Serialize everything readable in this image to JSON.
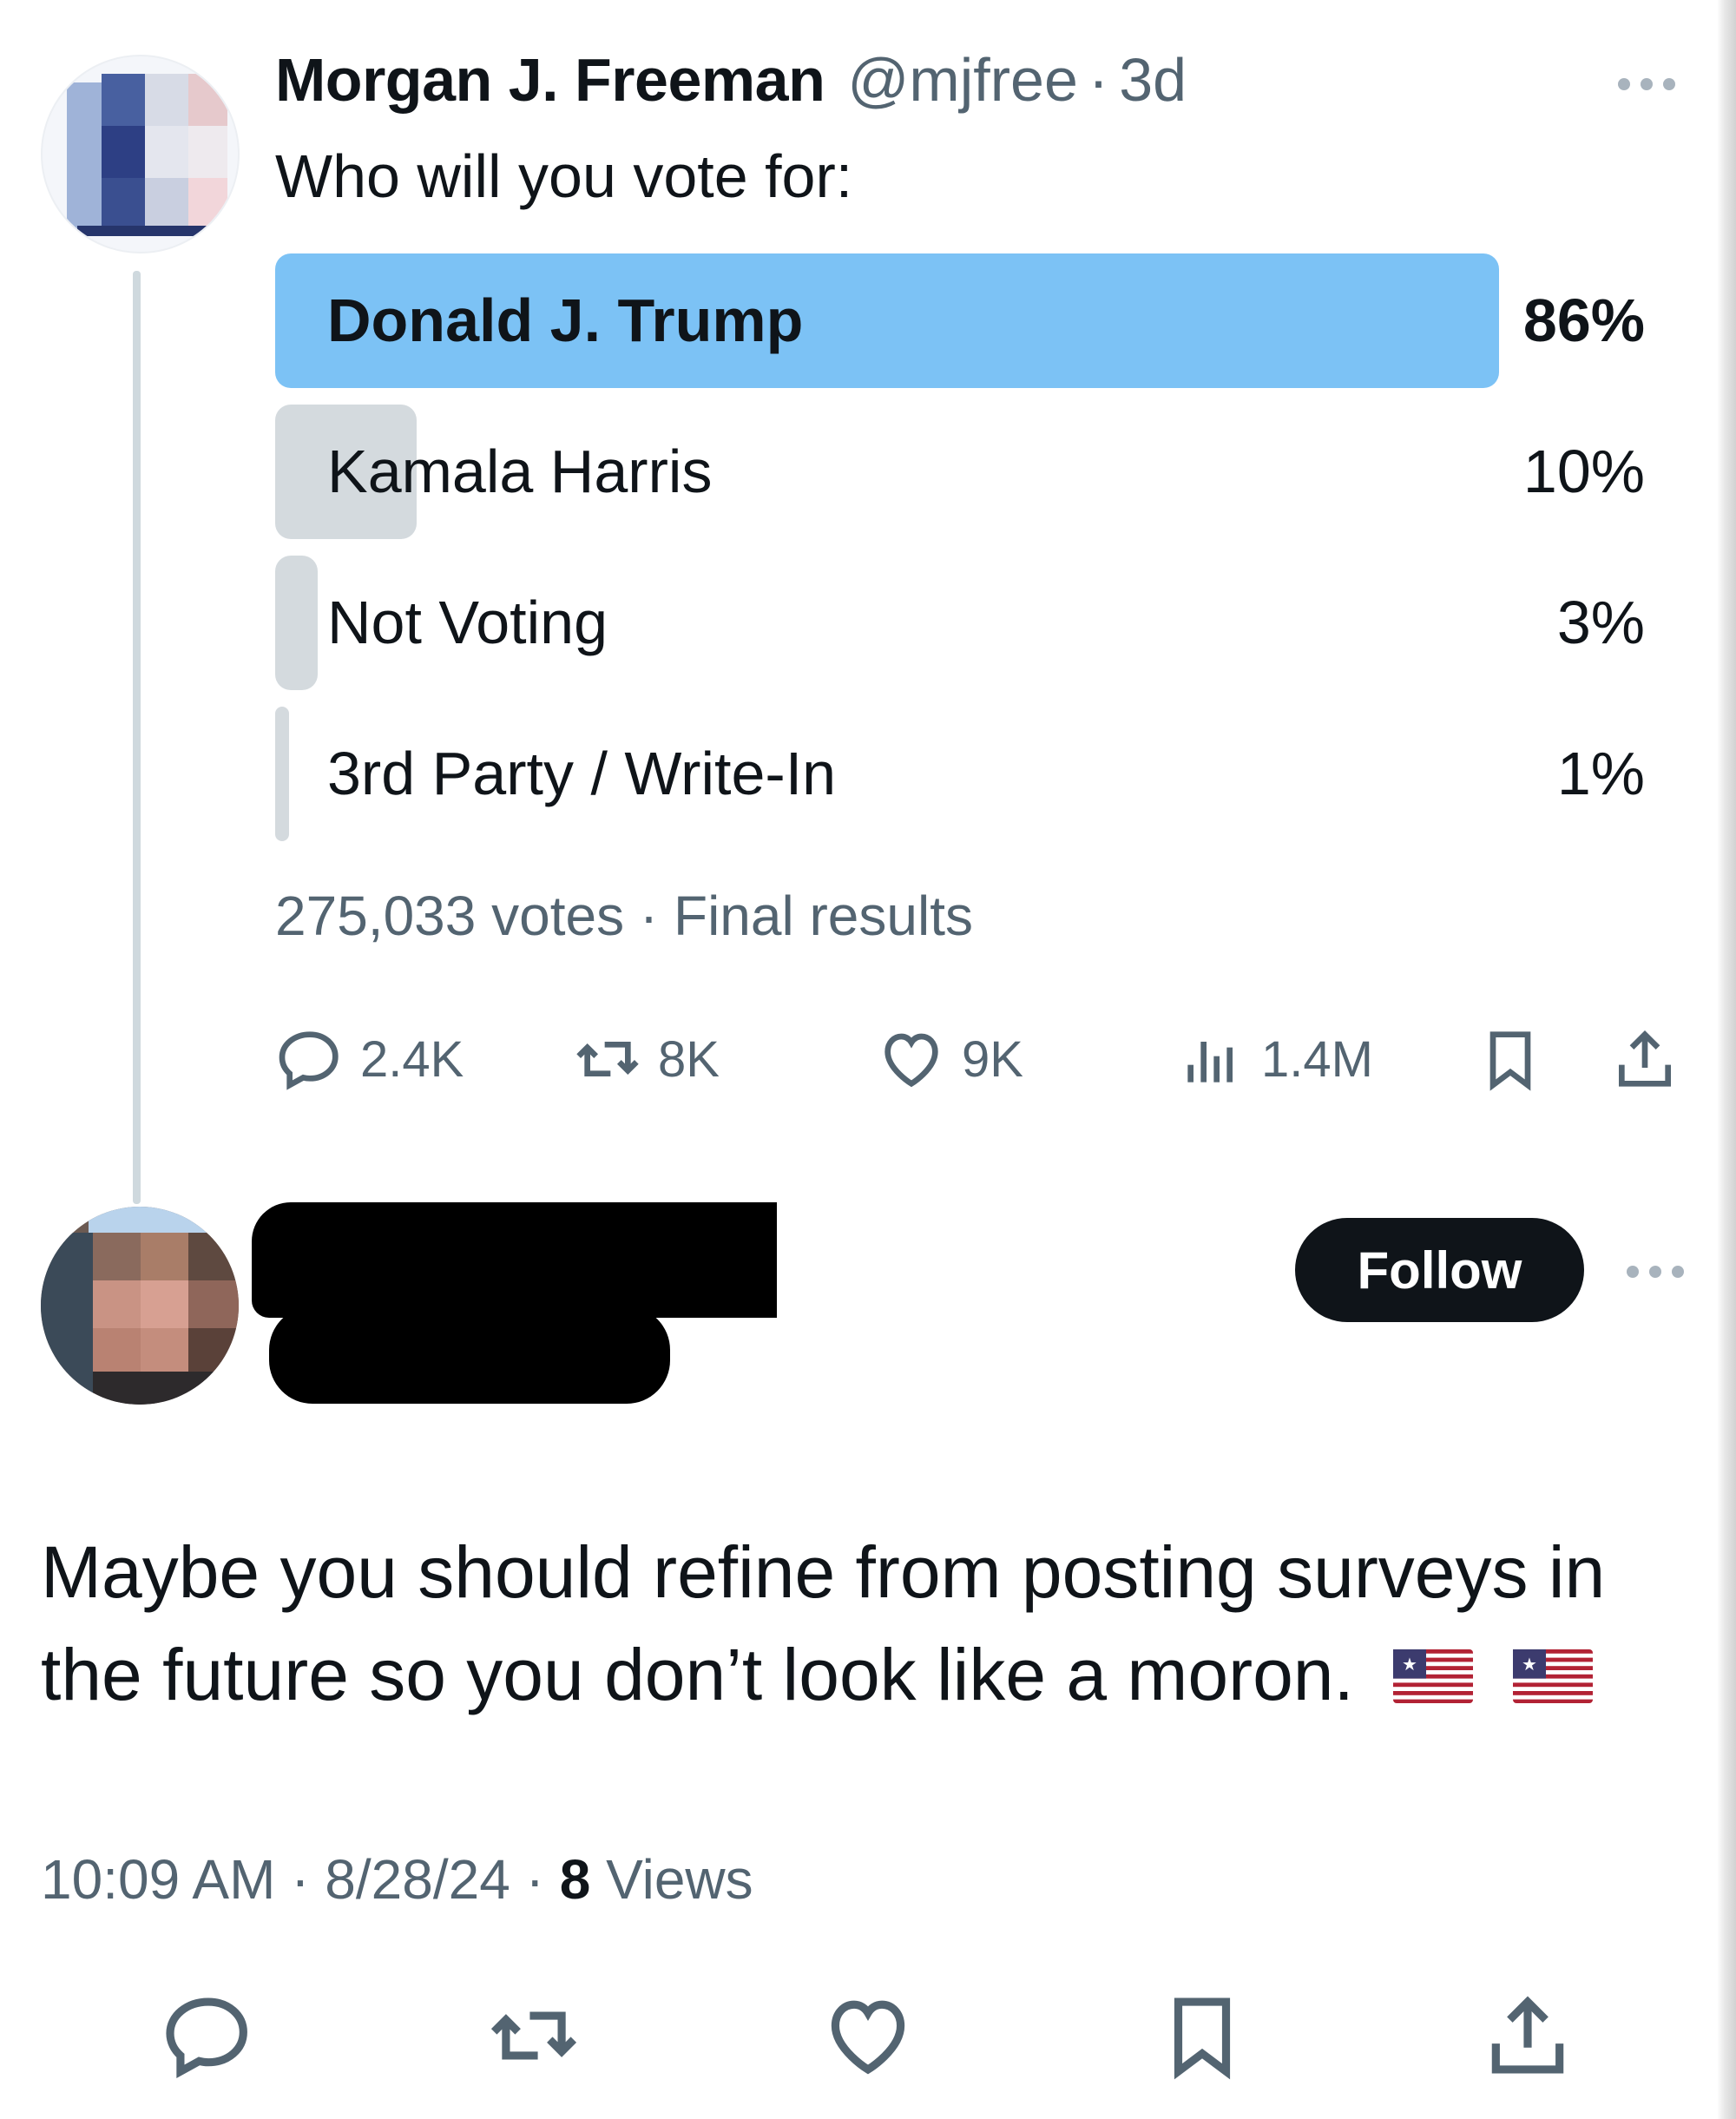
{
  "tweet": {
    "display_name": "Morgan J. Freeman",
    "handle": "@mjfree",
    "separator": "·",
    "age": "3d",
    "text": "Who will you vote for:"
  },
  "poll": {
    "options": [
      {
        "label": "Donald J. Trump",
        "percent_text": "86%",
        "fraction": 0.86,
        "winner": true
      },
      {
        "label": "Kamala Harris",
        "percent_text": "10%",
        "fraction": 0.1,
        "winner": false
      },
      {
        "label": "Not Voting",
        "percent_text": "3%",
        "fraction": 0.03,
        "winner": false
      },
      {
        "label": "3rd Party / Write-In",
        "percent_text": "1%",
        "fraction": 0.01,
        "winner": false
      }
    ],
    "votes": "275,033 votes",
    "separator": "·",
    "status": "Final results"
  },
  "actions": {
    "reply_count": "2.4K",
    "repost_count": "8K",
    "like_count": "9K",
    "view_count": "1.4M"
  },
  "reply": {
    "follow_label": "Follow",
    "text": "Maybe you should refine from posting surveys in the future so you don’t look like a moron.",
    "time": "10:09 AM",
    "separator": "·",
    "date": "8/28/24",
    "views_count": "8",
    "views_label": "Views"
  },
  "colors": {
    "poll_winner": "#7cc2f5",
    "poll_other": "#d4dade",
    "text_primary": "#0f1419",
    "text_secondary": "#536471",
    "follow_button": "#0f1419"
  },
  "icons": {
    "reply": "reply-icon",
    "repost": "repost-icon",
    "like": "like-icon",
    "views": "views-icon",
    "bookmark": "bookmark-icon",
    "share": "share-icon",
    "more": "more-icon",
    "flag": "us-flag-emoji"
  }
}
